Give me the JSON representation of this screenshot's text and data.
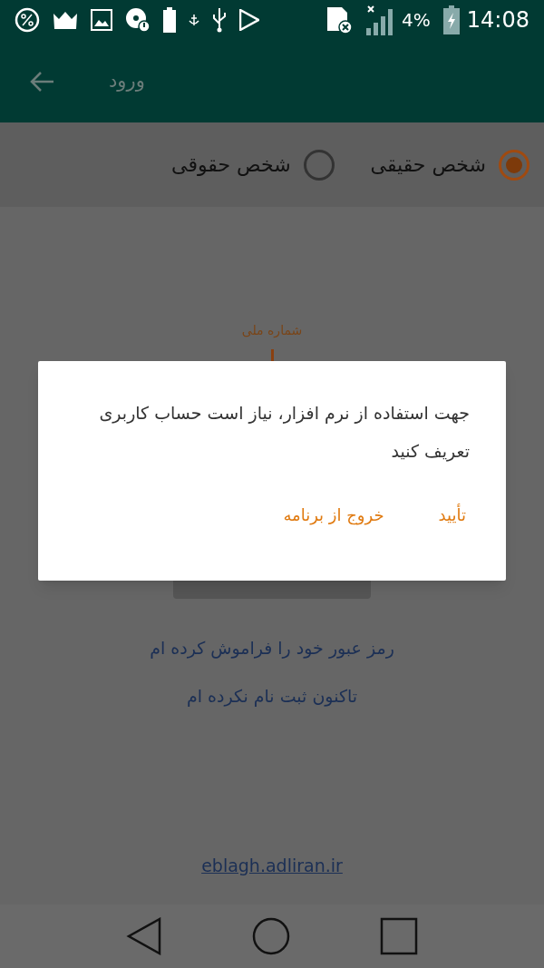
{
  "status_bar": {
    "battery_text": "4%",
    "time": "14:08"
  },
  "app_bar": {
    "title": "ورود"
  },
  "person_type": [
    {
      "label": "شخص حقیقی",
      "selected": true
    },
    {
      "label": "شخص حقوقی",
      "selected": false
    }
  ],
  "national_id_field": {
    "label": "شماره ملی"
  },
  "links": [
    "رمز عبور خود را فراموش کرده ام",
    "تاکنون ثبت نام نکرده ام"
  ],
  "footer_link": "eblagh.adliran.ir",
  "dialog": {
    "message": "جهت استفاده از نرم افزار، نیاز است حساب کاربری تعریف کنید",
    "buttons": [
      "تأیید",
      "خروج از برنامه"
    ]
  }
}
